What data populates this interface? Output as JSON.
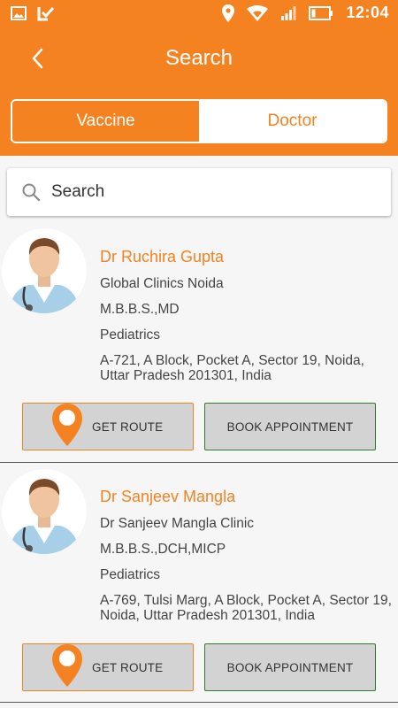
{
  "status_bar": {
    "time": "12:04",
    "left_icons": [
      "image-icon",
      "download-check-icon"
    ],
    "right_icons": [
      "location-pin-icon",
      "wifi-icon",
      "signal-icon",
      "battery-icon"
    ]
  },
  "header": {
    "back_icon": "chevron-left-icon",
    "title": "Search"
  },
  "tabs": [
    {
      "label": "Vaccine",
      "active": true
    },
    {
      "label": "Doctor",
      "active": false
    }
  ],
  "search": {
    "placeholder": "Search",
    "icon": "search-icon"
  },
  "doctors": [
    {
      "name": "Dr Ruchira Gupta",
      "clinic": "Global Clinics Noida",
      "qualification": "M.B.B.S.,MD",
      "specialty": "Pediatrics",
      "address_line1": "A-721, A Block, Pocket A, Sector 19, Noida,",
      "address_line2": "Uttar Pradesh 201301, India",
      "route_label": "GET ROUTE",
      "book_label": "BOOK APPOINTMENT"
    },
    {
      "name": "Dr Sanjeev Mangla",
      "clinic": "Dr Sanjeev Mangla Clinic",
      "qualification": "M.B.B.S.,DCH,MICP",
      "specialty": "Pediatrics",
      "address_line1": "A-769, Tulsi Marg, A Block, Pocket A, Sector 19,",
      "address_line2": "Noida, Uttar Pradesh 201301, India",
      "route_label": "GET ROUTE",
      "book_label": "BOOK APPOINTMENT"
    }
  ],
  "colors": {
    "brand": "#f58220",
    "button_bg": "#d3d3d3",
    "book_border": "#2e7d32",
    "background": "#f6f6f6"
  }
}
